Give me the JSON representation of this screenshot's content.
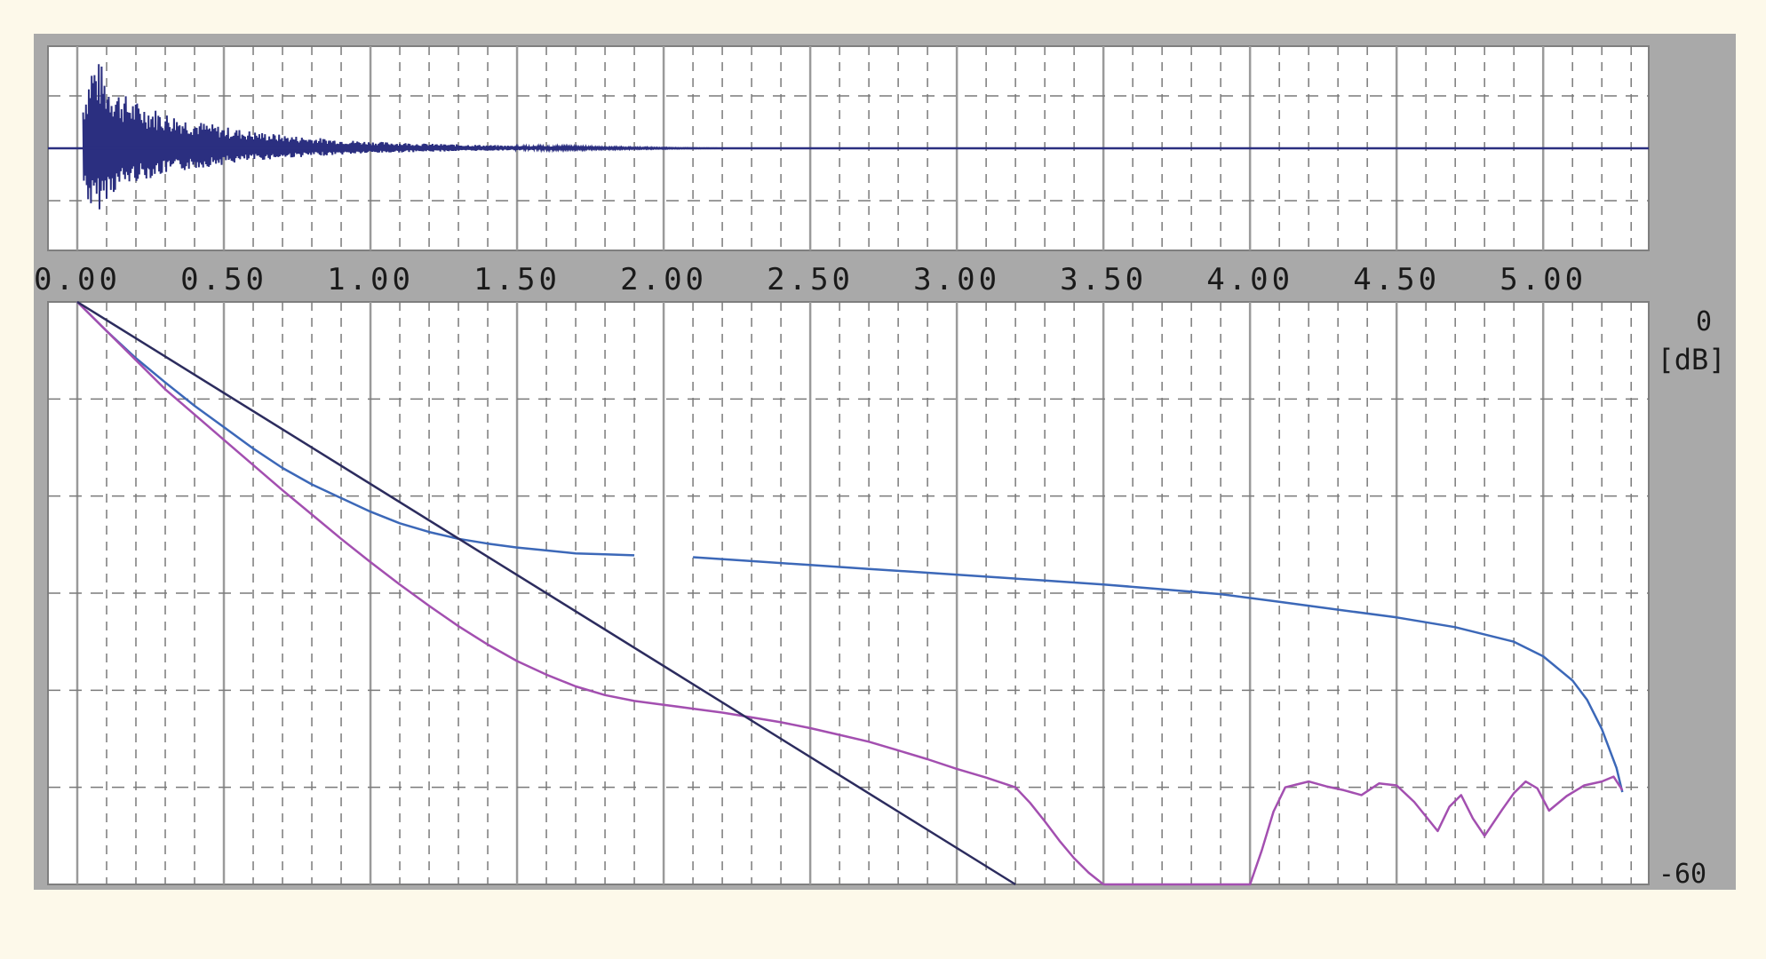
{
  "chart_data": [
    {
      "type": "line",
      "panel": "impulse-response",
      "title": "",
      "xlabel": "",
      "ylabel": "",
      "xlim": [
        -0.1,
        5.36
      ],
      "ylim": [
        -1,
        1
      ],
      "grid": true,
      "colors": {
        "waveform": "#2b2f80",
        "baseline": "#2b2f80"
      },
      "envelope": {
        "x": [
          0.02,
          0.05,
          0.08,
          0.1,
          0.15,
          0.2,
          0.3,
          0.4,
          0.5,
          0.6,
          0.7,
          0.8,
          0.9,
          1.0,
          1.2,
          1.4,
          1.6,
          1.8,
          2.0,
          2.2
        ],
        "upper": [
          0.55,
          1.0,
          0.95,
          0.78,
          0.62,
          0.52,
          0.4,
          0.31,
          0.24,
          0.19,
          0.15,
          0.12,
          0.095,
          0.075,
          0.05,
          0.035,
          0.022,
          0.013,
          0.007,
          0.0
        ],
        "lower": [
          -0.45,
          -0.72,
          -0.68,
          -0.56,
          -0.44,
          -0.37,
          -0.29,
          -0.23,
          -0.18,
          -0.14,
          -0.11,
          -0.09,
          -0.07,
          -0.055,
          -0.038,
          -0.026,
          -0.016,
          -0.01,
          -0.005,
          0.0
        ]
      }
    },
    {
      "type": "line",
      "panel": "decay-curves",
      "title": "",
      "xlabel": "",
      "ylabel": "[dB]",
      "xticks": [
        "0.00",
        "0.50",
        "1.00",
        "1.50",
        "2.00",
        "2.50",
        "3.00",
        "3.50",
        "4.00",
        "4.50",
        "5.00"
      ],
      "xtick_values": [
        0,
        0.5,
        1.0,
        1.5,
        2.0,
        2.5,
        3.0,
        3.5,
        4.0,
        4.5,
        5.0
      ],
      "ytick_top": "0",
      "ytick_bottom": "-60",
      "xlim": [
        -0.1,
        5.36
      ],
      "ylim": [
        -60,
        0
      ],
      "grid": true,
      "series": [
        {
          "color": "#3c68b8",
          "segments": [
            {
              "x": [
                0.0,
                0.1,
                0.2,
                0.3,
                0.4,
                0.5,
                0.6,
                0.7,
                0.8,
                0.9,
                1.0,
                1.1,
                1.2,
                1.3,
                1.4,
                1.5,
                1.6,
                1.7,
                1.8,
                1.9
              ],
              "y": [
                0,
                -3.0,
                -5.8,
                -8.3,
                -10.7,
                -12.9,
                -15.1,
                -17.1,
                -18.8,
                -20.2,
                -21.6,
                -22.8,
                -23.7,
                -24.4,
                -24.9,
                -25.3,
                -25.6,
                -25.9,
                -26.0,
                -26.1
              ]
            },
            {
              "x": [
                2.1,
                2.3,
                2.5,
                2.7,
                2.9,
                3.1,
                3.3,
                3.5,
                3.7,
                3.9,
                4.1,
                4.3,
                4.5,
                4.7,
                4.9,
                5.0,
                5.1,
                5.15,
                5.2,
                5.25,
                5.27
              ],
              "y": [
                -26.3,
                -26.7,
                -27.1,
                -27.5,
                -27.9,
                -28.3,
                -28.7,
                -29.1,
                -29.6,
                -30.1,
                -30.9,
                -31.7,
                -32.5,
                -33.5,
                -35.0,
                -36.5,
                -39.0,
                -41.0,
                -44.0,
                -48.0,
                -50.5
              ]
            }
          ]
        },
        {
          "color": "#a34fb0",
          "segments": [
            {
              "x": [
                0.0,
                0.1,
                0.2,
                0.3,
                0.4,
                0.5,
                0.6,
                0.7,
                0.8,
                0.9,
                1.0,
                1.1,
                1.2,
                1.3,
                1.4,
                1.5,
                1.6,
                1.7,
                1.8,
                1.9,
                2.0,
                2.1,
                2.2,
                2.3,
                2.4,
                2.5,
                2.6,
                2.7,
                2.8,
                2.9,
                3.0,
                3.1,
                3.2,
                3.25,
                3.3,
                3.35,
                3.4,
                3.45,
                3.5
              ],
              "y": [
                0,
                -3.0,
                -6.0,
                -9.0,
                -11.6,
                -14.2,
                -16.8,
                -19.4,
                -21.9,
                -24.4,
                -26.8,
                -29.1,
                -31.3,
                -33.4,
                -35.3,
                -37.0,
                -38.4,
                -39.6,
                -40.5,
                -41.1,
                -41.5,
                -41.9,
                -42.3,
                -42.8,
                -43.3,
                -43.9,
                -44.6,
                -45.3,
                -46.2,
                -47.1,
                -48.1,
                -49.0,
                -50.0,
                -51.6,
                -53.5,
                -55.5,
                -57.3,
                -58.8,
                -60
              ]
            },
            {
              "x": [
                3.5,
                3.6,
                3.7,
                3.8,
                3.9,
                4.0,
                4.04,
                4.08,
                4.12,
                4.16,
                4.2,
                4.26,
                4.32,
                4.38,
                4.44,
                4.5,
                4.56,
                4.6,
                4.64,
                4.68,
                4.72,
                4.76,
                4.8,
                4.86,
                4.9,
                4.94,
                4.98,
                5.02,
                5.08,
                5.14,
                5.2,
                5.24,
                5.27
              ],
              "y": [
                -60,
                -60,
                -60,
                -60,
                -60,
                -60,
                -56.5,
                -52.5,
                -50.0,
                -49.7,
                -49.4,
                -49.9,
                -50.3,
                -50.8,
                -49.6,
                -49.8,
                -51.5,
                -53.0,
                -54.5,
                -52.0,
                -50.8,
                -53.2,
                -55.0,
                -52.3,
                -50.6,
                -49.4,
                -50.1,
                -52.4,
                -50.9,
                -49.8,
                -49.4,
                -48.9,
                -50.3
              ]
            }
          ]
        },
        {
          "color": "#2c2c5e",
          "segments": [
            {
              "x": [
                0.0,
                3.2
              ],
              "y": [
                0,
                -60.0
              ]
            }
          ]
        }
      ]
    }
  ]
}
